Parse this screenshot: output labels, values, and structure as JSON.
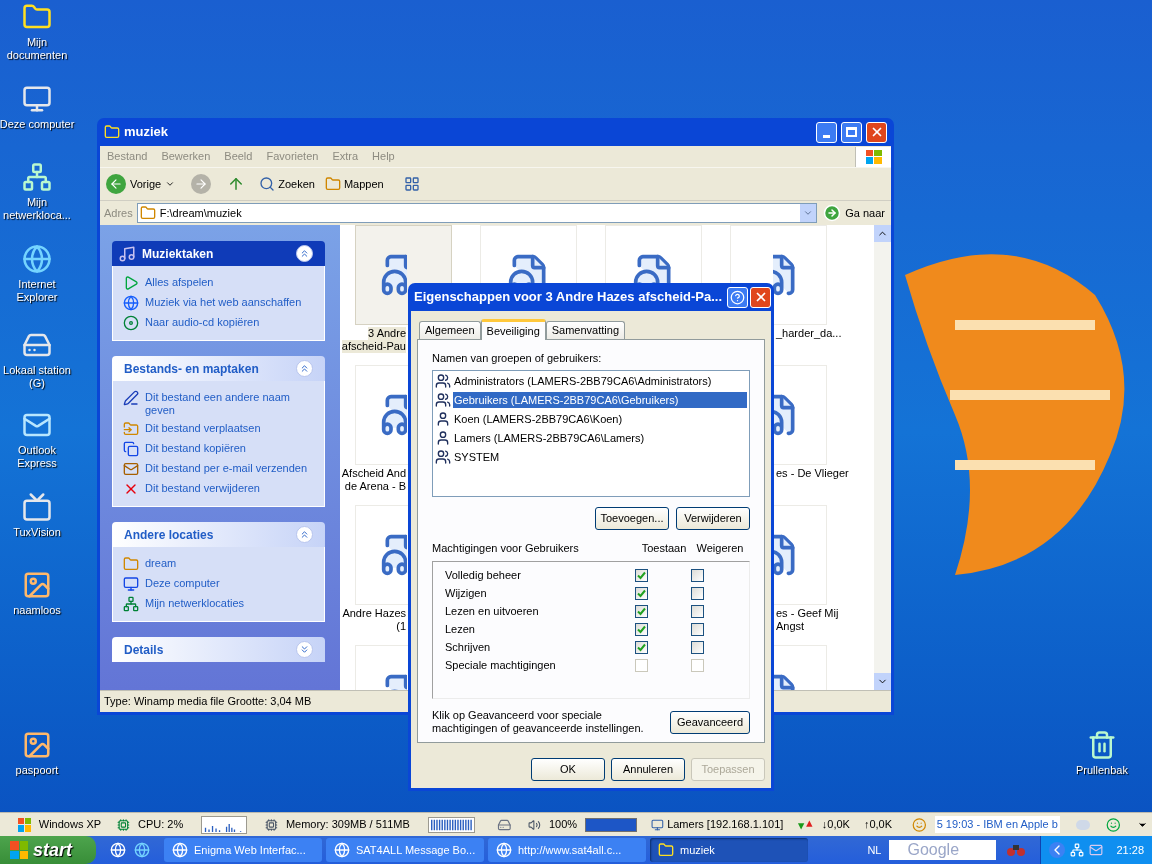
{
  "desktop_icons": [
    {
      "label": "Mijn documenten",
      "kind": "documents"
    },
    {
      "label": "Deze computer",
      "kind": "computer"
    },
    {
      "label": "Mijn netwerkloca...",
      "kind": "network"
    },
    {
      "label": "Internet Explorer",
      "kind": "browser"
    },
    {
      "label": "Lokaal station (G)",
      "kind": "drive"
    },
    {
      "label": "Outlook Express",
      "kind": "mail"
    },
    {
      "label": "TuxVision",
      "kind": "tv"
    },
    {
      "label": "naamloos",
      "kind": "image"
    },
    {
      "label": "paspoort",
      "kind": "image"
    },
    {
      "label": "Prullenbak",
      "kind": "trash"
    }
  ],
  "explorer": {
    "title": "muziek",
    "menu": [
      "Bestand",
      "Bewerken",
      "Beeld",
      "Favorieten",
      "Extra",
      "Help"
    ],
    "toolbar": {
      "back": "Vorige",
      "search": "Zoeken",
      "folders": "Mappen"
    },
    "address": {
      "label": "Adres",
      "value": "F:\\dream\\muziek",
      "go": "Ga naar"
    },
    "panels": [
      {
        "title": "Muziektaken",
        "expanded": true,
        "kind": "special",
        "items": [
          {
            "label": "Alles afspelen",
            "kind": "play"
          },
          {
            "label": "Muziek via het web aanschaffen",
            "kind": "globe"
          },
          {
            "label": "Naar audio-cd kopiëren",
            "kind": "disc"
          }
        ]
      },
      {
        "title": "Bestands- en maptaken",
        "expanded": true,
        "kind": "normal",
        "items": [
          {
            "label": "Dit bestand een andere naam geven",
            "kind": "rename"
          },
          {
            "label": "Dit bestand verplaatsen",
            "kind": "move"
          },
          {
            "label": "Dit bestand kopiëren",
            "kind": "copy"
          },
          {
            "label": "Dit bestand per e-mail verzenden",
            "kind": "mail"
          },
          {
            "label": "Dit bestand verwijderen",
            "kind": "delete"
          }
        ]
      },
      {
        "title": "Andere locaties",
        "expanded": true,
        "kind": "normal",
        "items": [
          {
            "label": "dream",
            "kind": "folder"
          },
          {
            "label": "Deze computer",
            "kind": "computer"
          },
          {
            "label": "Mijn netwerklocaties",
            "kind": "network"
          }
        ]
      },
      {
        "title": "Details",
        "expanded": false,
        "kind": "normal"
      }
    ],
    "file_rows": [
      {
        "tiles": [
          {
            "lines": [
              "3 Andre",
              "afscheid-Pau"
            ],
            "selected": true
          },
          {
            "selected": false
          },
          {
            "selected": false
          },
          {
            "lines": [
              "_harder_da..."
            ],
            "selected": false
          }
        ]
      },
      {
        "tiles": [
          {
            "lines": [
              "Afscheid And",
              "de Arena - B"
            ],
            "selected": false
          },
          {
            "lines": [
              "es - De Vlieger"
            ],
            "selected": false
          }
        ]
      },
      {
        "tiles": [
          {
            "lines": [
              "Andre Hazes",
              "(1"
            ],
            "selected": false
          },
          {
            "lines": [
              "es - Geef Mij",
              "Angst"
            ],
            "selected": false
          }
        ]
      },
      {
        "tiles": [
          {
            "selected": false
          },
          {
            "selected": false
          }
        ]
      }
    ],
    "status": "Type: Winamp media file Grootte: 3,04 MB"
  },
  "dialog": {
    "title": "Eigenschappen voor 3 Andre Hazes afscheid-Pa...",
    "tabs": [
      {
        "label": "Algemeen",
        "selected": false
      },
      {
        "label": "Beveiliging",
        "selected": true
      },
      {
        "label": "Samenvatting",
        "selected": false
      }
    ],
    "users_label": "Namen van groepen of gebruikers:",
    "users": [
      {
        "label": "Administrators (LAMERS-2BB79CA6\\Administrators)",
        "kind": "group",
        "selected": false
      },
      {
        "label": "Gebruikers (LAMERS-2BB79CA6\\Gebruikers)",
        "kind": "group",
        "selected": true
      },
      {
        "label": "Koen (LAMERS-2BB79CA6\\Koen)",
        "kind": "user",
        "selected": false
      },
      {
        "label": "Lamers (LAMERS-2BB79CA6\\Lamers)",
        "kind": "user",
        "selected": false
      },
      {
        "label": "SYSTEM",
        "kind": "group",
        "selected": false
      }
    ],
    "add": "Toevoegen...",
    "remove": "Verwijderen",
    "permissions_label": "Machtigingen voor Gebruikers",
    "allow_label": "Toestaan",
    "deny_label": "Weigeren",
    "permissions": [
      {
        "label": "Volledig beheer",
        "allow": true,
        "deny": false,
        "disabled": false
      },
      {
        "label": "Wijzigen",
        "allow": true,
        "deny": false,
        "disabled": false
      },
      {
        "label": "Lezen en uitvoeren",
        "allow": true,
        "deny": false,
        "disabled": false
      },
      {
        "label": "Lezen",
        "allow": true,
        "deny": false,
        "disabled": false
      },
      {
        "label": "Schrijven",
        "allow": true,
        "deny": false,
        "disabled": false
      },
      {
        "label": "Speciale machtigingen",
        "allow": false,
        "deny": false,
        "disabled": true
      }
    ],
    "note": "Klik op Geavanceerd voor speciale machtigingen of geavanceerde instellingen.",
    "advanced": "Geavanceerd",
    "buttons": [
      {
        "label": "OK",
        "disabled": false
      },
      {
        "label": "Annuleren",
        "disabled": false
      },
      {
        "label": "Toepassen",
        "disabled": true
      }
    ]
  },
  "toolbar_strip": {
    "os": "Windows XP",
    "cpu": "CPU: 2%",
    "memory": "Memory: 309MB / 511MB",
    "volume": "100%",
    "network": "Lamers [192.168.1.101]",
    "down": "↓0,0K",
    "up": "↑0,0K",
    "ticker": "5 19:03 - IBM en Apple b"
  },
  "taskbar": {
    "start": "start",
    "tasks": [
      {
        "label": "Enigma Web Interfac...",
        "selected": false
      },
      {
        "label": "SAT4ALL Message Bo...",
        "selected": false
      },
      {
        "label": "http://www.sat4all.c...",
        "selected": false
      },
      {
        "label": "muziek",
        "selected": true
      }
    ],
    "language": "NL",
    "search_placeholder": "Google",
    "clock": "21:28"
  }
}
